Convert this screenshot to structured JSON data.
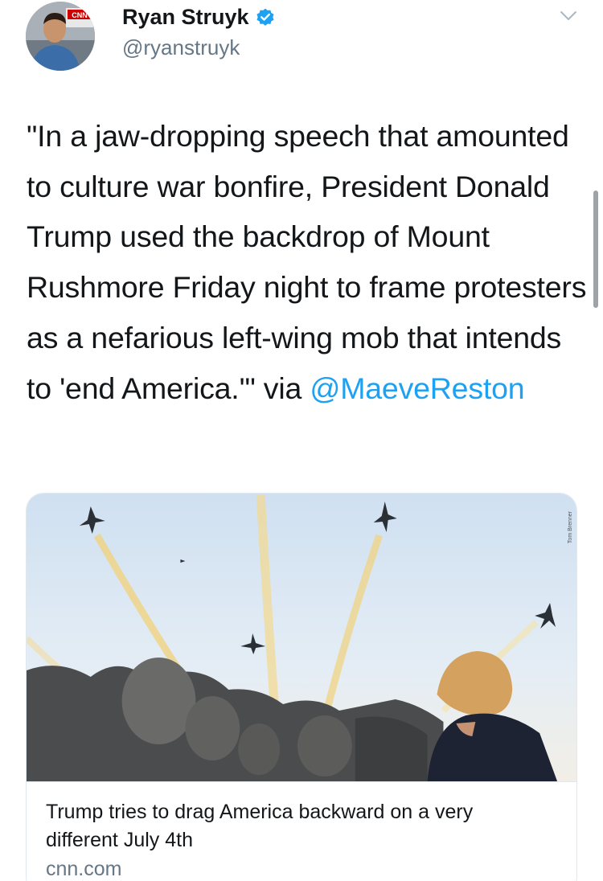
{
  "author": {
    "name": "Ryan Struyk",
    "handle": "@ryanstruyk",
    "verified": true,
    "avatar_badge": "CNN"
  },
  "tweet": {
    "text_before_mention": "\"In a jaw-dropping speech that amounted to culture war bonfire, President Donald Trump used the backdrop of Mount Rushmore Friday night to frame protesters as a nefarious left-wing mob that intends to 'end America.'\" via ",
    "mention": "@MaeveReston"
  },
  "card": {
    "title": "Trump tries to drag America backward on a very different July 4th",
    "domain": "cnn.com",
    "image_alt": "Jets fly over Mount Rushmore as Trump watches",
    "image_credit": "Tom Brenner"
  },
  "icons": {
    "verified": "verified-badge-icon",
    "menu": "chevron-down-icon"
  },
  "colors": {
    "link": "#1da1f2",
    "secondary_text": "#657786",
    "border": "#e1e8ed"
  }
}
